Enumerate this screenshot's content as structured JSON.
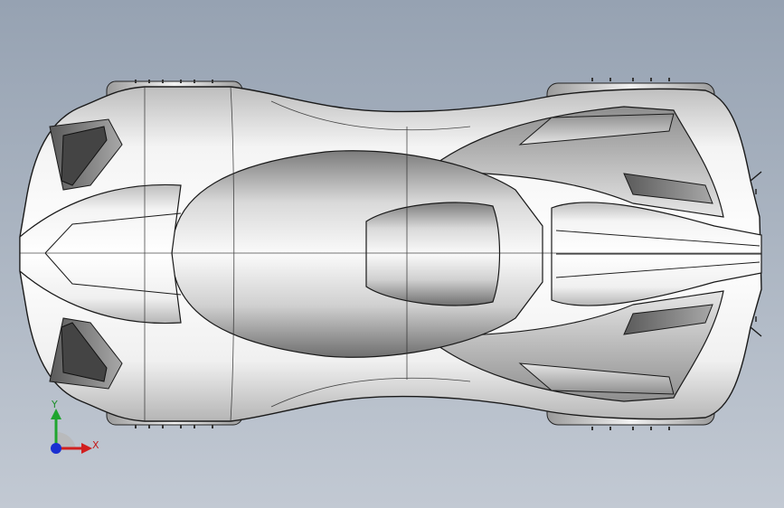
{
  "viewport": {
    "background_top": "#96a2b2",
    "background_bottom": "#c2c9d3",
    "view": "top"
  },
  "model": {
    "kind": "concept car body, top view",
    "render_style": "shaded with edges",
    "body_color": "#e9e9e9",
    "edge_color": "#1a1a1a"
  },
  "triad": {
    "x_label": "X",
    "y_label": "Y",
    "x_color": "#d11f1f",
    "y_color": "#1fa52f",
    "z_color": "#1a2fd1"
  }
}
